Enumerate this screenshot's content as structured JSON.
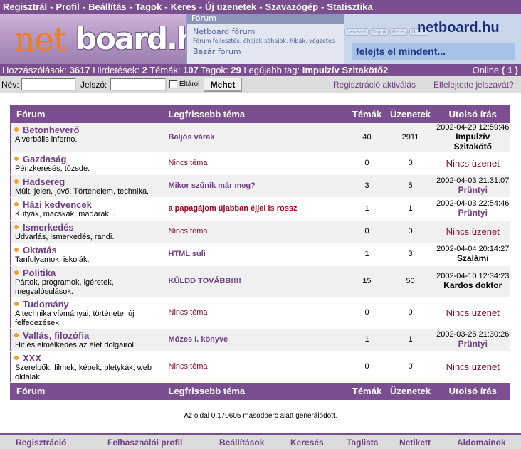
{
  "top_menu": {
    "items": [
      "Regisztrál",
      "Profil",
      "Beállítás",
      "Tagok",
      "Keres",
      "Új üzenetek",
      "Szavazógép",
      "Statisztika"
    ],
    "separator": "-"
  },
  "banner": {
    "logo_part1": "net",
    "logo_part2": "board.hu",
    "forum_header": "Fórum",
    "forum_title": "Netboard fórum",
    "forum_subtitle": "Fórum fejlesztés, óhajok-sóhajok, hibák, végzetes",
    "forum_title2": "Bazár fórum",
    "site_name": "netboard.hu",
    "slogan": "felejts el mindent...",
    "tag_buttons": [
      "bevezet",
      "Tagok",
      "Keres",
      "Üj ü..."
    ]
  },
  "stats": {
    "posts_label": "Hozzászólások:",
    "posts_value": "3617",
    "ads_label": "Hirdetések:",
    "ads_value": "2",
    "topics_label": "Témák:",
    "topics_value": "107",
    "members_label": "Tagok:",
    "members_value": "29",
    "newest_label": "Legújabb tag:",
    "newest_value": "Impulzív Szitakötő2",
    "online_label": "Online",
    "online_value": "( 1 )"
  },
  "login": {
    "name_label": "Név:",
    "name_value": "",
    "password_label": "Jelszó:",
    "password_value": "",
    "remember_label": "Eltárol",
    "submit_label": "Mehet",
    "activation_link": "Regisztráció aktiválás",
    "forgot_link": "Elfelejtette jelszavát?"
  },
  "table": {
    "headers": {
      "forum": "Fórum",
      "latest": "Legfrissebb téma",
      "topics": "Témák",
      "messages": "Üzenetek",
      "last": "Utolsó írás"
    },
    "rows": [
      {
        "name": "Betonheverő",
        "desc": "A verbális inferno.",
        "topic": "Baljós várak",
        "has_topic": true,
        "hot": false,
        "topics": "40",
        "messages": "2911",
        "last_date": "2002-04-29 12:59:46",
        "last_user": "Impulzív Szitakötő",
        "user_style": "black"
      },
      {
        "name": "Gazdaság",
        "desc": "Pénzkeresés, tőzsde.",
        "topic": "Nincs téma",
        "has_topic": false,
        "hot": false,
        "topics": "0",
        "messages": "0",
        "last_date": "",
        "last_user": "Nincs üzenet",
        "user_style": "none"
      },
      {
        "name": "Hadsereg",
        "desc": "Múlt, jelen, jövő. Történelem, technika.",
        "topic": "Mikor szűnik már meg?",
        "has_topic": true,
        "hot": false,
        "topics": "3",
        "messages": "5",
        "last_date": "2002-04-03 21:31:07",
        "last_user": "Prüntyi",
        "user_style": "purple"
      },
      {
        "name": "Házi kedvencek",
        "desc": "Kutyák, macskák, madarak...",
        "topic": "a papagájom újabban éjjel is rossz",
        "has_topic": true,
        "hot": true,
        "topics": "1",
        "messages": "1",
        "last_date": "2002-04-03 22:54:46",
        "last_user": "Prüntyi",
        "user_style": "purple"
      },
      {
        "name": "Ismerkedés",
        "desc": "Udvarlás, ismerkedés, randi.",
        "topic": "Nincs téma",
        "has_topic": false,
        "hot": false,
        "topics": "0",
        "messages": "0",
        "last_date": "",
        "last_user": "Nincs üzenet",
        "user_style": "none"
      },
      {
        "name": "Oktatás",
        "desc": "Tanfolyamok, iskolák.",
        "topic": "HTML suli",
        "has_topic": true,
        "hot": false,
        "topics": "1",
        "messages": "3",
        "last_date": "2002-04-04 20:14:27",
        "last_user": "Szalámi",
        "user_style": "black"
      },
      {
        "name": "Politika",
        "desc": "Pártok, programok, igéretek, megvalósulások.",
        "topic": "KÜLDD TOVÁBB!!!!",
        "has_topic": true,
        "hot": false,
        "topics": "15",
        "messages": "50",
        "last_date": "2002-04-10 12:34:23",
        "last_user": "Kardos doktor",
        "user_style": "black"
      },
      {
        "name": "Tudomány",
        "desc": "A technika vívmányai, története, új felfedezések.",
        "topic": "Nincs téma",
        "has_topic": false,
        "hot": false,
        "topics": "0",
        "messages": "0",
        "last_date": "",
        "last_user": "Nincs üzenet",
        "user_style": "none"
      },
      {
        "name": "Vallás, filozófia",
        "desc": "Hit és elmélkedés az élet dolgairól.",
        "topic": "Mózes I. könyve",
        "has_topic": true,
        "hot": false,
        "topics": "1",
        "messages": "1",
        "last_date": "2002-03-25 21:30:26",
        "last_user": "Prüntyi",
        "user_style": "purple"
      },
      {
        "name": "XXX",
        "desc": "Szerelpők, filmek, képek, pletykák, web oldalak.",
        "topic": "Nincs téma",
        "has_topic": false,
        "hot": false,
        "topics": "0",
        "messages": "0",
        "last_date": "",
        "last_user": "Nincs üzenet",
        "user_style": "none"
      }
    ]
  },
  "generated_text": "Az oldal 0.170605 másodperc alatt generálódott.",
  "bottom_menu": [
    "Regisztráció",
    "Felhasználói profil",
    "Beállítások",
    "Keresés",
    "Taglista",
    "Netikett",
    "Aldomainok"
  ],
  "colors": {
    "accent": "#7b4f8f",
    "link": "#6f3d84",
    "hot": "#a8001c",
    "bullet": "#f0a02a"
  }
}
